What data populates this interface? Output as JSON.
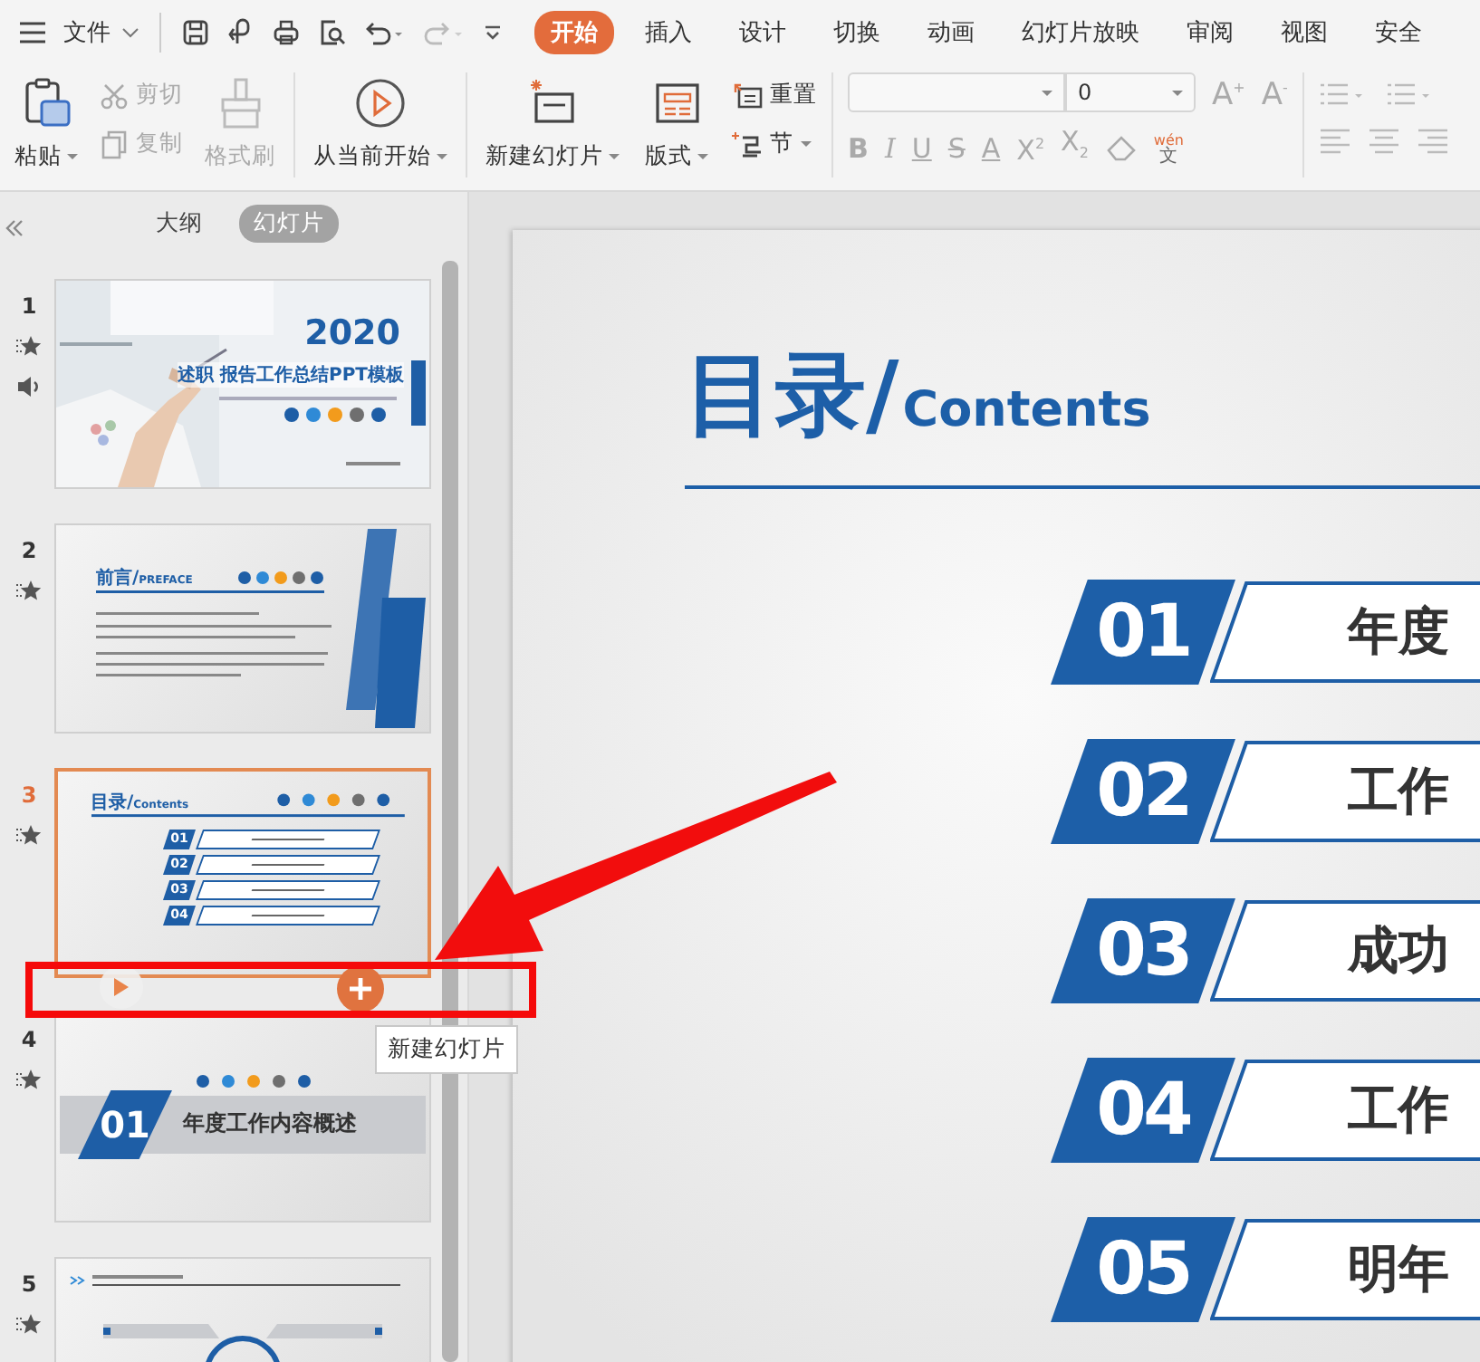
{
  "menu_bar": {
    "file_label": "文件",
    "tabs": [
      {
        "label": "开始",
        "selected": true
      },
      {
        "label": "插入",
        "selected": false
      },
      {
        "label": "设计",
        "selected": false
      },
      {
        "label": "切换",
        "selected": false
      },
      {
        "label": "动画",
        "selected": false
      },
      {
        "label": "幻灯片放映",
        "selected": false
      },
      {
        "label": "审阅",
        "selected": false
      },
      {
        "label": "视图",
        "selected": false
      },
      {
        "label": "安全",
        "selected": false
      }
    ]
  },
  "ribbon": {
    "clipboard": {
      "paste": {
        "label": "粘贴",
        "disabled": false
      },
      "cut": {
        "label": "剪切",
        "disabled": true
      },
      "copy": {
        "label": "复制",
        "disabled": true
      },
      "format_painter": {
        "label": "格式刷",
        "disabled": true
      }
    },
    "slideshow": {
      "label": "从当前开始"
    },
    "slides": {
      "new_slide": "新建幻灯片",
      "layout": "版式",
      "reset": "重置",
      "section": "节"
    },
    "font": {
      "disabled": true,
      "size": "0",
      "grow": "A$^{+}$",
      "shrink": "A$^{-}$",
      "styles": [
        "B",
        "I",
        "U",
        "S",
        "A",
        "X$^{2}$",
        "X$_{2}$"
      ],
      "phonetic_top": "wén",
      "phonetic_bottom": "文"
    }
  },
  "panel": {
    "tabs": [
      {
        "label": "大纲",
        "selected": false
      },
      {
        "label": "幻灯片",
        "selected": true
      }
    ],
    "slides": [
      {
        "number": "1",
        "selected": false,
        "animated": true,
        "sound": true,
        "kind": "cover",
        "title": "2020",
        "subtitle": "述职 报告工作总结PPT模板"
      },
      {
        "number": "2",
        "selected": false,
        "animated": true,
        "kind": "preface",
        "title": "前言/",
        "subtitle": "PREFACE"
      },
      {
        "number": "3",
        "selected": true,
        "animated": true,
        "kind": "contents",
        "title": "目录/",
        "subtitle": "Contents",
        "items": [
          "01",
          "02",
          "03",
          "04"
        ]
      },
      {
        "number": "4",
        "selected": false,
        "animated": true,
        "kind": "section",
        "badge": "01",
        "title": "年度工作内容概述"
      },
      {
        "number": "5",
        "selected": false,
        "animated": true,
        "kind": "diagram"
      }
    ],
    "tooltip": "新建幻灯片"
  },
  "slide": {
    "title": "目录/",
    "subtitle": "Contents",
    "items": [
      {
        "number": "01",
        "text": "年度"
      },
      {
        "number": "02",
        "text": "工作"
      },
      {
        "number": "03",
        "text": "成功"
      },
      {
        "number": "04",
        "text": "工作"
      },
      {
        "number": "05",
        "text": "明年"
      }
    ]
  }
}
